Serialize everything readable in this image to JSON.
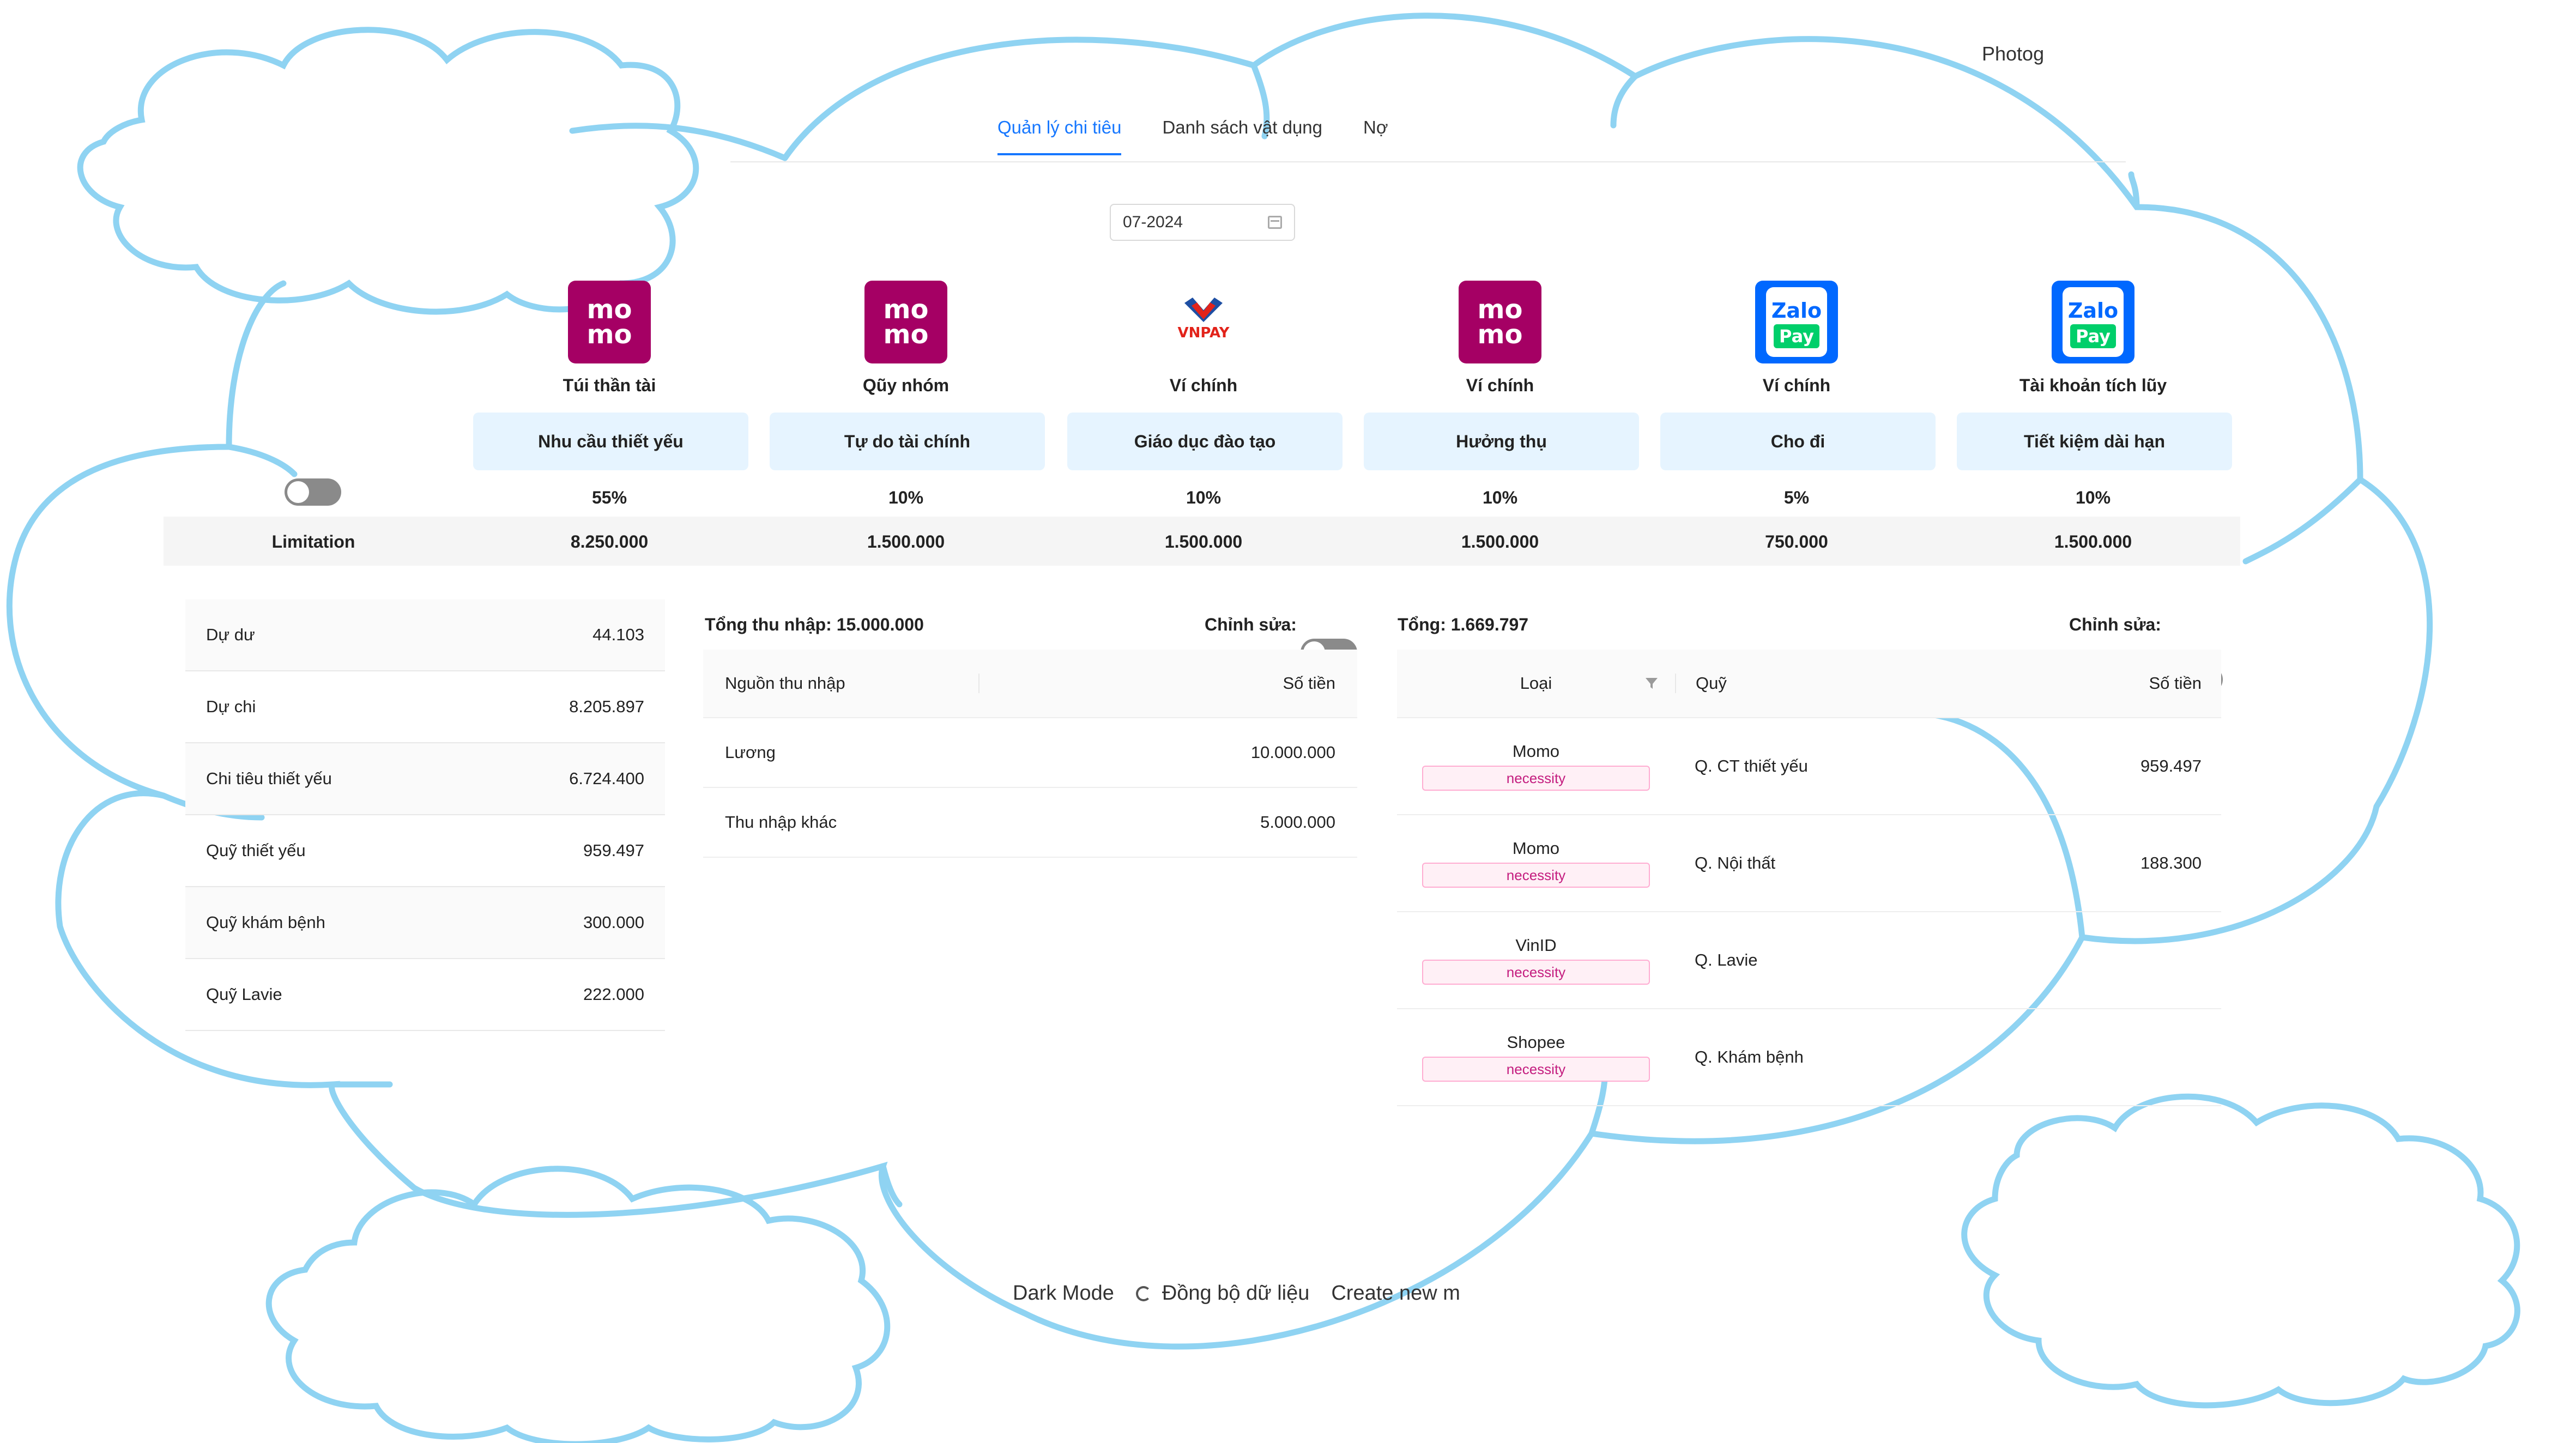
{
  "header": {
    "photo_label": "Photog"
  },
  "tabs": [
    {
      "label": "Quản lý chi tiêu",
      "active": true
    },
    {
      "label": "Danh sách vật dụng",
      "active": false
    },
    {
      "label": "Nợ",
      "active": false
    }
  ],
  "date_picker": {
    "value": "07-2024",
    "icon": "calendar-icon"
  },
  "wallets": [
    {
      "logo": "momo",
      "logo_text": "mo\nmo",
      "name": "Túi thần tài",
      "fund": "Nhu cầu thiết yếu",
      "percent": "55%",
      "limit": "8.250.000"
    },
    {
      "logo": "momo",
      "logo_text": "mo\nmo",
      "name": "Qũy nhóm",
      "fund": "Tự do tài chính",
      "percent": "10%",
      "limit": "1.500.000"
    },
    {
      "logo": "vnpay",
      "logo_text": "VNPAY",
      "name": "Ví chính",
      "fund": "Giáo dục đào tạo",
      "percent": "10%",
      "limit": "1.500.000"
    },
    {
      "logo": "momo",
      "logo_text": "mo\nmo",
      "name": "Ví chính",
      "fund": "Hưởng thụ",
      "percent": "10%",
      "limit": "1.500.000"
    },
    {
      "logo": "zalopay",
      "logo_text": "Zalo Pay",
      "name": "Ví chính",
      "fund": "Cho đi",
      "percent": "5%",
      "limit": "750.000"
    },
    {
      "logo": "zalopay",
      "logo_text": "Zalo Pay",
      "name": "Tài khoản tích lũy",
      "fund": "Tiết kiệm dài hạn",
      "percent": "10%",
      "limit": "1.500.000"
    }
  ],
  "limitation": {
    "label": "Limitation",
    "toggle_on": false
  },
  "summary": [
    {
      "label": "Dự dư",
      "value": "44.103"
    },
    {
      "label": "Dự chi",
      "value": "8.205.897"
    },
    {
      "label": "Chi tiêu thiết yếu",
      "value": "6.724.400"
    },
    {
      "label": "Quỹ thiết yếu",
      "value": "959.497"
    },
    {
      "label": "Quỹ khám bệnh",
      "value": "300.000"
    },
    {
      "label": "Quỹ Lavie",
      "value": "222.000"
    }
  ],
  "income": {
    "title": "Tổng thu nhập: 15.000.000",
    "edit_label": "Chỉnh sửa:",
    "columns": [
      "Nguồn thu nhập",
      "Số tiền"
    ],
    "rows": [
      {
        "source": "Lương",
        "amount": "10.000.000"
      },
      {
        "source": "Thu nhập khác",
        "amount": "5.000.000"
      }
    ]
  },
  "expenses": {
    "title": "Tổng: 1.669.797",
    "edit_label": "Chỉnh sửa:",
    "columns": [
      "Loại",
      "Quỹ",
      "Số tiền"
    ],
    "rows": [
      {
        "type": "Momo",
        "tag": "necessity",
        "fund": "Q. CT thiết yếu",
        "amount": "959.497"
      },
      {
        "type": "Momo",
        "tag": "necessity",
        "fund": "Q. Nội thất",
        "amount": "188.300"
      },
      {
        "type": "VinID",
        "tag": "necessity",
        "fund": "Q. Lavie",
        "amount": ""
      },
      {
        "type": "Shopee",
        "tag": "necessity",
        "fund": "Q. Khám bệnh",
        "amount": ""
      }
    ]
  },
  "footer": {
    "dark_mode": "Dark Mode",
    "sync": "Đồng bộ dữ liệu",
    "create": "Create new m"
  }
}
